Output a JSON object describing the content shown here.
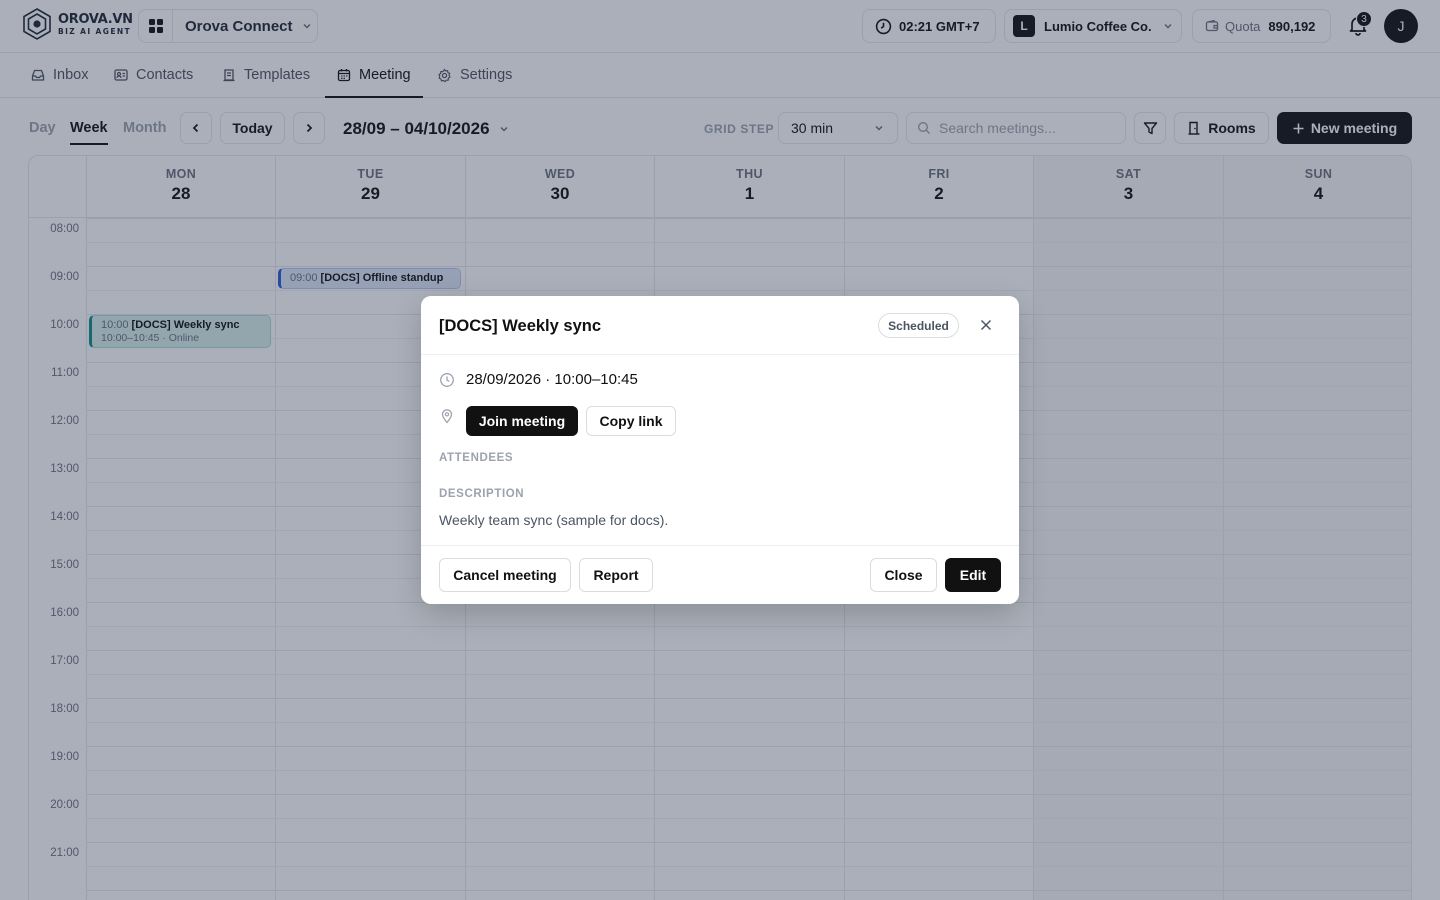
{
  "app": {
    "brand": "OROVA.VN",
    "brand_sub": "BIZ AI AGENT",
    "workspace": "Orova Connect",
    "time": "02:21 GMT+7",
    "org_initial": "L",
    "org_name": "Lumio Coffee Co.",
    "quota_label": "Quota",
    "quota_value": "890,192",
    "notifications": "3",
    "avatar_initial": "J"
  },
  "nav": {
    "items": [
      {
        "label": "Inbox",
        "icon": "inbox-icon"
      },
      {
        "label": "Contacts",
        "icon": "contacts-icon"
      },
      {
        "label": "Templates",
        "icon": "templates-icon"
      },
      {
        "label": "Meeting",
        "icon": "calendar-icon"
      },
      {
        "label": "Settings",
        "icon": "gear-icon"
      }
    ],
    "active": "Meeting"
  },
  "toolbar": {
    "views": [
      "Day",
      "Week",
      "Month"
    ],
    "active_view": "Week",
    "today_label": "Today",
    "date_range": "28/09 – 04/10/2026",
    "grid_step_label": "GRID STEP",
    "grid_step_value": "30 min",
    "search_placeholder": "Search meetings...",
    "rooms_label": "Rooms",
    "new_meeting_label": "New meeting"
  },
  "calendar": {
    "days": [
      {
        "name": "MON",
        "date": "28"
      },
      {
        "name": "TUE",
        "date": "29"
      },
      {
        "name": "WED",
        "date": "30"
      },
      {
        "name": "THU",
        "date": "1"
      },
      {
        "name": "FRI",
        "date": "2"
      },
      {
        "name": "SAT",
        "date": "3"
      },
      {
        "name": "SUN",
        "date": "4"
      }
    ],
    "hours": [
      "08:00",
      "09:00",
      "10:00",
      "11:00",
      "12:00",
      "13:00",
      "14:00",
      "15:00",
      "16:00",
      "17:00",
      "18:00",
      "19:00",
      "20:00",
      "21:00"
    ],
    "events": [
      {
        "time": "10:00",
        "title": "[DOCS] Weekly sync",
        "sub": "10:00–10:45 · Online",
        "color": "#0f8e86"
      },
      {
        "time": "09:00",
        "title": "[DOCS] Offline standup",
        "color": "#2f5bd8"
      }
    ]
  },
  "modal": {
    "title": "[DOCS] Weekly sync",
    "status": "Scheduled",
    "datetime": "28/09/2026 · 10:00–10:45",
    "join_label": "Join meeting",
    "copy_link_label": "Copy link",
    "attendees_label": "ATTENDEES",
    "description_label": "DESCRIPTION",
    "description": "Weekly team sync (sample for docs).",
    "cancel_label": "Cancel meeting",
    "report_label": "Report",
    "close_label": "Close",
    "edit_label": "Edit"
  }
}
